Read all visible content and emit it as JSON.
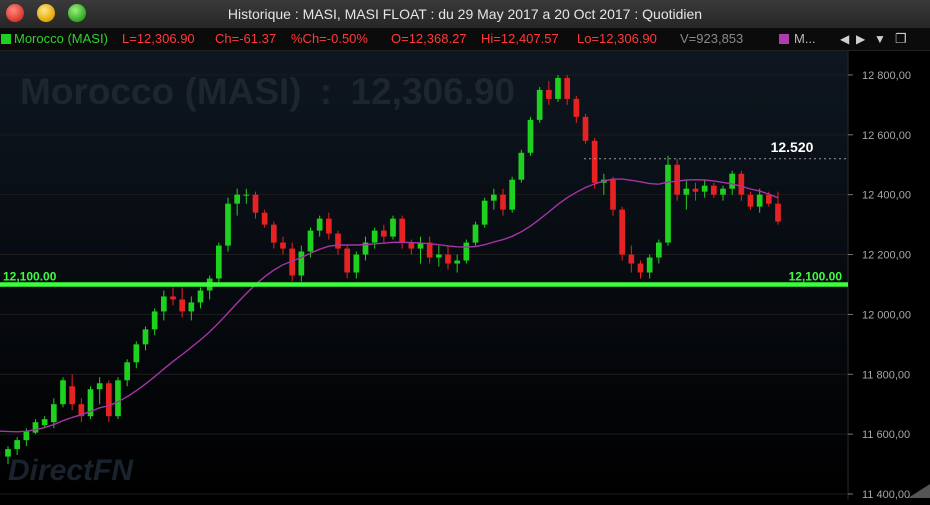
{
  "window": {
    "title": "Historique : MASI, MASI FLOAT : du 29 May 2017 a 20 Oct 2017 : Quotidien"
  },
  "infobar": {
    "symbol": "Morocco (MASI)",
    "last": "L=12,306.90",
    "change": "Ch=-61.37",
    "pct_change": "%Ch=-0.50%",
    "open": "O=12,368.27",
    "high": "Hi=12,407.57",
    "low": "Lo=12,306.90",
    "volume": "V=923,853",
    "indicator": "M...",
    "icons": [
      "triangle-left-icon",
      "triangle-right-icon",
      "triangle-down-icon",
      "window-restore-icon"
    ]
  },
  "watermark": {
    "symbol": "Morocco (MASI)",
    "separator": ":",
    "value": "12,306.90",
    "brand": "DirectFN"
  },
  "colors": {
    "up": "#1fd11f",
    "down": "#e62222",
    "ma": "#a534a5",
    "support": "#3cff3c",
    "background": "#000000",
    "info_label": "#ff3a3a",
    "volume_text": "#8a8a8a",
    "grid": "#1d1d1d"
  },
  "chart_data": {
    "type": "candlestick",
    "yaxis": {
      "ticks": [
        "12 800,00",
        "12 600,00",
        "12 400,00",
        "12 200,00",
        "12 000,00",
        "11 800,00",
        "11 600,00",
        "11 400,00"
      ],
      "tick_values": [
        12800,
        12600,
        12400,
        12200,
        12000,
        11800,
        11600,
        11400
      ],
      "range": [
        11380,
        12880
      ]
    },
    "support_line": {
      "value": 12100,
      "label_left": "12,100.00",
      "label_right": "12,100.00"
    },
    "resistance_line": {
      "value": 12520,
      "label": "12.520",
      "style": "dotted"
    },
    "ohlc": [
      [
        11525,
        11560,
        11500,
        11550
      ],
      [
        11550,
        11590,
        11530,
        11580
      ],
      [
        11580,
        11620,
        11560,
        11610
      ],
      [
        11605,
        11650,
        11600,
        11640
      ],
      [
        11630,
        11660,
        11620,
        11650
      ],
      [
        11640,
        11720,
        11620,
        11700
      ],
      [
        11700,
        11790,
        11690,
        11780
      ],
      [
        11760,
        11800,
        11680,
        11700
      ],
      [
        11700,
        11720,
        11640,
        11660
      ],
      [
        11660,
        11760,
        11650,
        11750
      ],
      [
        11750,
        11790,
        11700,
        11770
      ],
      [
        11770,
        11780,
        11640,
        11660
      ],
      [
        11660,
        11790,
        11650,
        11780
      ],
      [
        11780,
        11850,
        11760,
        11840
      ],
      [
        11840,
        11910,
        11820,
        11900
      ],
      [
        11900,
        11960,
        11880,
        11950
      ],
      [
        11950,
        12020,
        11930,
        12010
      ],
      [
        12010,
        12080,
        11980,
        12060
      ],
      [
        12060,
        12090,
        12030,
        12050
      ],
      [
        12050,
        12090,
        11990,
        12010
      ],
      [
        12010,
        12060,
        11980,
        12040
      ],
      [
        12040,
        12090,
        12020,
        12080
      ],
      [
        12080,
        12130,
        12050,
        12120
      ],
      [
        12120,
        12240,
        12100,
        12230
      ],
      [
        12230,
        12390,
        12210,
        12370
      ],
      [
        12370,
        12420,
        12330,
        12400
      ],
      [
        12400,
        12420,
        12370,
        12400
      ],
      [
        12400,
        12410,
        12320,
        12340
      ],
      [
        12340,
        12350,
        12290,
        12300
      ],
      [
        12300,
        12310,
        12220,
        12240
      ],
      [
        12240,
        12260,
        12200,
        12220
      ],
      [
        12220,
        12240,
        12110,
        12130
      ],
      [
        12130,
        12230,
        12110,
        12210
      ],
      [
        12210,
        12290,
        12190,
        12280
      ],
      [
        12280,
        12330,
        12260,
        12320
      ],
      [
        12320,
        12340,
        12250,
        12270
      ],
      [
        12270,
        12280,
        12200,
        12220
      ],
      [
        12220,
        12230,
        12120,
        12140
      ],
      [
        12140,
        12210,
        12120,
        12200
      ],
      [
        12200,
        12260,
        12180,
        12240
      ],
      [
        12240,
        12290,
        12220,
        12280
      ],
      [
        12280,
        12300,
        12240,
        12260
      ],
      [
        12260,
        12330,
        12250,
        12320
      ],
      [
        12320,
        12330,
        12220,
        12240
      ],
      [
        12240,
        12250,
        12200,
        12220
      ],
      [
        12220,
        12260,
        12170,
        12240
      ],
      [
        12240,
        12260,
        12170,
        12190
      ],
      [
        12190,
        12230,
        12160,
        12200
      ],
      [
        12200,
        12230,
        12150,
        12170
      ],
      [
        12170,
        12200,
        12140,
        12180
      ],
      [
        12180,
        12250,
        12170,
        12240
      ],
      [
        12240,
        12310,
        12230,
        12300
      ],
      [
        12300,
        12390,
        12290,
        12380
      ],
      [
        12380,
        12420,
        12350,
        12400
      ],
      [
        12400,
        12420,
        12330,
        12350
      ],
      [
        12350,
        12460,
        12340,
        12450
      ],
      [
        12450,
        12550,
        12440,
        12540
      ],
      [
        12540,
        12660,
        12530,
        12650
      ],
      [
        12650,
        12760,
        12640,
        12750
      ],
      [
        12750,
        12780,
        12700,
        12720
      ],
      [
        12720,
        12800,
        12710,
        12790
      ],
      [
        12790,
        12800,
        12700,
        12720
      ],
      [
        12720,
        12730,
        12640,
        12660
      ],
      [
        12660,
        12670,
        12570,
        12580
      ],
      [
        12580,
        12590,
        12420,
        12440
      ],
      [
        12440,
        12470,
        12400,
        12450
      ],
      [
        12450,
        12460,
        12330,
        12350
      ],
      [
        12350,
        12360,
        12180,
        12200
      ],
      [
        12200,
        12230,
        12140,
        12170
      ],
      [
        12170,
        12180,
        12120,
        12140
      ],
      [
        12140,
        12200,
        12120,
        12190
      ],
      [
        12190,
        12250,
        12170,
        12240
      ],
      [
        12240,
        12530,
        12230,
        12500
      ],
      [
        12500,
        12520,
        12380,
        12400
      ],
      [
        12400,
        12450,
        12350,
        12420
      ],
      [
        12420,
        12440,
        12380,
        12410
      ],
      [
        12410,
        12450,
        12390,
        12430
      ],
      [
        12430,
        12440,
        12390,
        12400
      ],
      [
        12400,
        12430,
        12380,
        12420
      ],
      [
        12420,
        12480,
        12400,
        12470
      ],
      [
        12470,
        12480,
        12380,
        12400
      ],
      [
        12400,
        12410,
        12350,
        12360
      ],
      [
        12360,
        12420,
        12340,
        12400
      ],
      [
        12400,
        12410,
        12360,
        12370
      ],
      [
        12370,
        12410,
        12300,
        12310
      ]
    ],
    "ma": [
      11610,
      11608,
      11610,
      11615,
      11622,
      11632,
      11645,
      11656,
      11665,
      11676,
      11688,
      11695,
      11708,
      11725,
      11745,
      11768,
      11792,
      11818,
      11843,
      11866,
      11890,
      11915,
      11942,
      11972,
      12005,
      12038,
      12070,
      12100,
      12126,
      12148,
      12166,
      12178,
      12190,
      12204,
      12218,
      12228,
      12232,
      12232,
      12232,
      12233,
      12236,
      12238,
      12241,
      12241,
      12240,
      12239,
      12236,
      12233,
      12229,
      12226,
      12225,
      12227,
      12233,
      12242,
      12250,
      12261,
      12276,
      12295,
      12318,
      12342,
      12368,
      12390,
      12408,
      12424,
      12436,
      12446,
      12452,
      12452,
      12448,
      12443,
      12437,
      12435,
      12442,
      12445,
      12449,
      12450,
      12449,
      12446,
      12441,
      12436,
      12428,
      12419,
      12412,
      12402,
      12390
    ]
  }
}
